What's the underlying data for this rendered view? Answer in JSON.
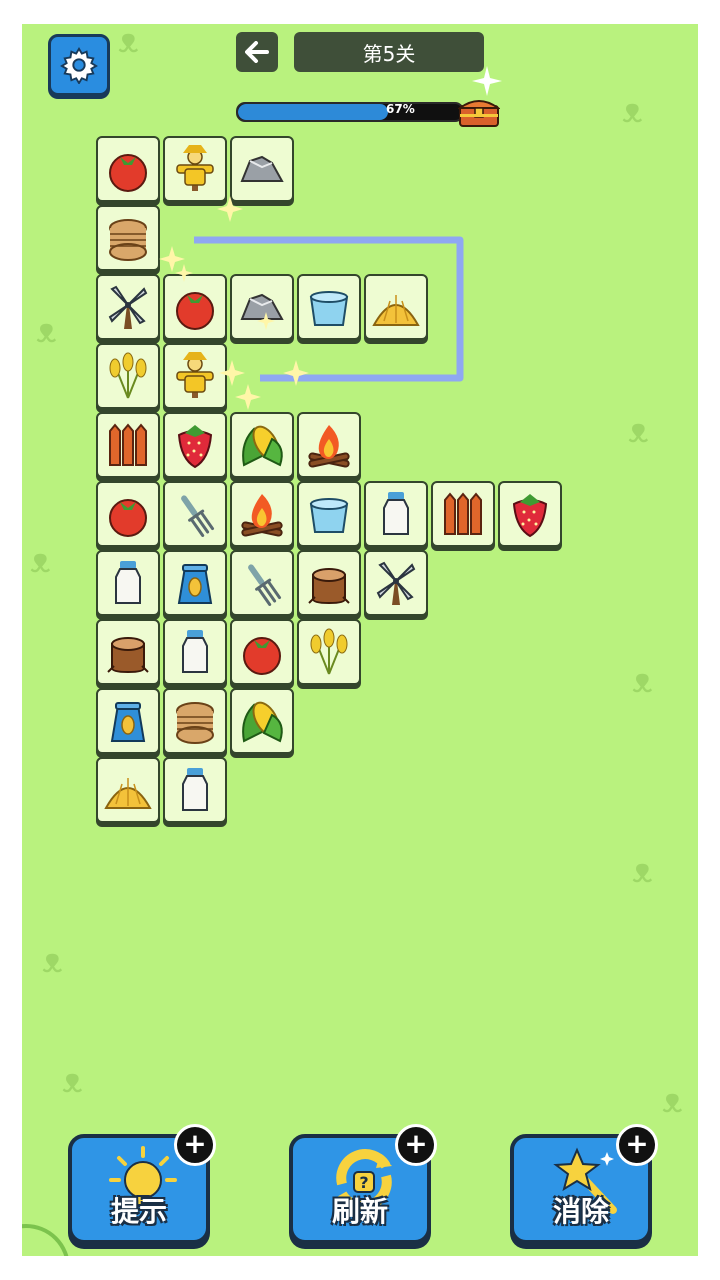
{
  "header": {
    "level_title": "第5关",
    "progress_percent": 67,
    "progress_label": "67%"
  },
  "icons": {
    "settings": "gear-icon",
    "back": "arrow-left-icon",
    "reward": "treasure-chest-icon"
  },
  "board": {
    "rows": [
      [
        "tomato",
        "scarecrow",
        "rock"
      ],
      [
        "rope"
      ],
      [
        "windmill",
        "tomato",
        "rock",
        "water-bucket",
        "haystack"
      ],
      [
        "wheat",
        "scarecrow"
      ],
      [
        "fence",
        "strawberry",
        "corn",
        "campfire"
      ],
      [
        "tomato",
        "garden-fork",
        "campfire",
        "water-bucket",
        "milk-bottle",
        "fence",
        "strawberry"
      ],
      [
        "milk-bottle",
        "seed-bag",
        "garden-fork",
        "tree-stump",
        "windmill"
      ],
      [
        "tree-stump",
        "milk-bottle",
        "tomato",
        "wheat"
      ],
      [
        "seed-bag",
        "rope",
        "corn"
      ],
      [
        "haystack",
        "milk-bottle"
      ]
    ]
  },
  "buttons": {
    "hint_label": "提示",
    "refresh_label": "刷新",
    "remove_label": "消除",
    "plus_label": "+"
  },
  "colors": {
    "background": "#b9f27e",
    "tile_face": "#eefcd2",
    "button_blue": "#2f95e6",
    "progress_blue": "#2d8ad8",
    "link_path": "#8fa8f2"
  }
}
